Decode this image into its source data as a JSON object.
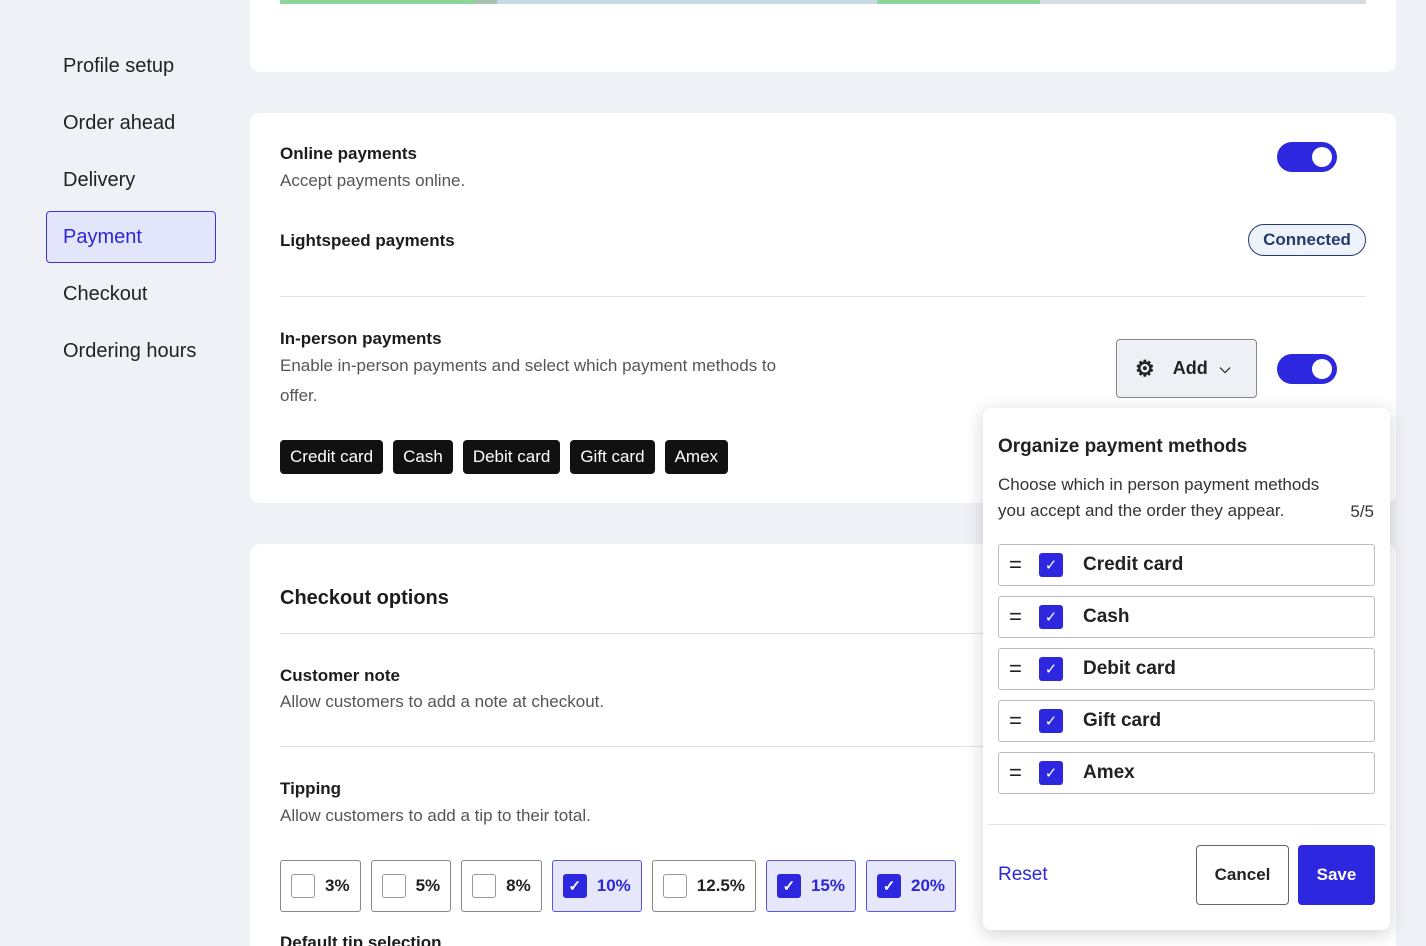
{
  "sidebar": {
    "items": [
      {
        "label": "Profile setup"
      },
      {
        "label": "Order ahead"
      },
      {
        "label": "Delivery"
      },
      {
        "label": "Payment"
      },
      {
        "label": "Checkout"
      },
      {
        "label": "Ordering hours"
      }
    ],
    "active": "Payment"
  },
  "payments": {
    "online": {
      "title": "Online payments",
      "desc": "Accept payments online.",
      "enabled": true
    },
    "lightspeed": {
      "title": "Lightspeed payments",
      "status": "Connected"
    },
    "in_person": {
      "title": "In-person payments",
      "desc": "Enable in-person payments and select which payment methods to offer.",
      "enabled": true,
      "add_label": "Add",
      "methods": [
        "Credit card",
        "Cash",
        "Debit card",
        "Gift card",
        "Amex"
      ]
    }
  },
  "checkout": {
    "title": "Checkout options",
    "customer_note": {
      "title": "Customer note",
      "desc": "Allow customers to add a note at checkout."
    },
    "tipping": {
      "title": "Tipping",
      "desc": "Allow customers to add a tip to their total.",
      "options": [
        {
          "label": "3%",
          "checked": false
        },
        {
          "label": "5%",
          "checked": false
        },
        {
          "label": "8%",
          "checked": false
        },
        {
          "label": "10%",
          "checked": true
        },
        {
          "label": "12.5%",
          "checked": false
        },
        {
          "label": "15%",
          "checked": true
        },
        {
          "label": "20%",
          "checked": true
        }
      ]
    },
    "default_tip_title": "Default tip selection"
  },
  "popover": {
    "title": "Organize payment methods",
    "desc": "Choose which in person payment methods you accept and the order they appear.",
    "count": "5/5",
    "items": [
      {
        "label": "Credit card",
        "checked": true
      },
      {
        "label": "Cash",
        "checked": true
      },
      {
        "label": "Debit card",
        "checked": true
      },
      {
        "label": "Gift card",
        "checked": true
      },
      {
        "label": "Amex",
        "checked": true
      }
    ],
    "reset_label": "Reset",
    "cancel_label": "Cancel",
    "save_label": "Save"
  },
  "colors": {
    "accent": "#2d27e0",
    "active_bg": "#e3e5fb",
    "page_bg": "#f0f1f6",
    "badge_border": "#233a6e"
  },
  "icons": {
    "settings": "gear-icon",
    "dropdown": "chevron-down-icon",
    "drag": "drag-handle-icon",
    "check": "check-icon"
  }
}
